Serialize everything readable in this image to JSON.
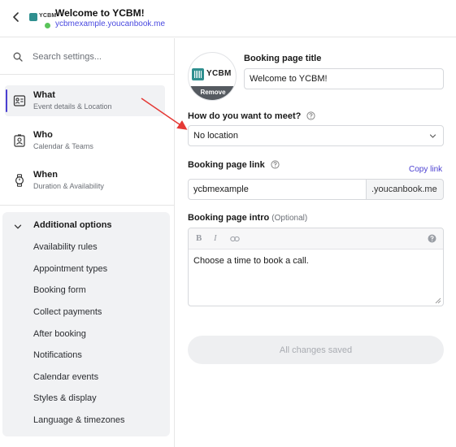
{
  "header": {
    "title": "Welcome to YCBM!",
    "url": "ycbmexample.youcanbook.me",
    "logo_text": "YCBM",
    "back_icon": "chevron-left-icon"
  },
  "sidebar": {
    "search_placeholder": "Search settings...",
    "nav": [
      {
        "title": "What",
        "subtitle": "Event details & Location",
        "icon": "id-card-icon",
        "active": true
      },
      {
        "title": "Who",
        "subtitle": "Calendar & Teams",
        "icon": "contact-card-icon",
        "active": false
      },
      {
        "title": "When",
        "subtitle": "Duration & Availability",
        "icon": "watch-icon",
        "active": false
      }
    ],
    "additional": {
      "title": "Additional options",
      "items": [
        "Availability rules",
        "Appointment types",
        "Booking form",
        "Collect payments",
        "After booking",
        "Notifications",
        "Calendar events",
        "Styles & display",
        "Language & timezones"
      ]
    }
  },
  "main": {
    "avatar": {
      "logo_text": "YCBM",
      "remove_label": "Remove"
    },
    "title_label": "Booking page title",
    "title_value": "Welcome to YCBM!",
    "meet_label": "How do you want to meet?",
    "meet_value": "No location",
    "link_label": "Booking page link",
    "copy_link": "Copy link",
    "link_value": "ycbmexample",
    "link_suffix": ".youcanbook.me",
    "intro_label": "Booking page intro",
    "intro_optional": "(Optional)",
    "toolbar": {
      "bold": "B",
      "italic": "I"
    },
    "intro_value": "Choose a time to book a call.",
    "save_label": "All changes saved"
  },
  "colors": {
    "accent": "#4a3fd1",
    "annotation_arrow": "#e53935",
    "online": "#5ac45a",
    "logo_teal": "#2f8f8f"
  }
}
